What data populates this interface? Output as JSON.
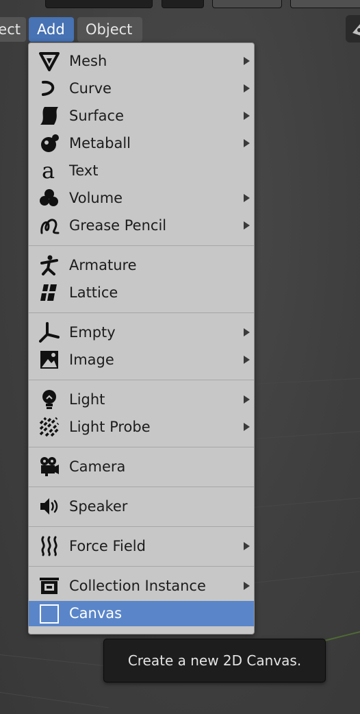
{
  "header": {
    "clipped_menu_label": "ect",
    "add_label": "Add",
    "object_label": "Object"
  },
  "menu": {
    "items": [
      {
        "label": "Mesh",
        "icon": "mesh-cone-icon",
        "submenu": true
      },
      {
        "label": "Curve",
        "icon": "curve-icon",
        "submenu": true
      },
      {
        "label": "Surface",
        "icon": "surface-icon",
        "submenu": true
      },
      {
        "label": "Metaball",
        "icon": "metaball-icon",
        "submenu": true
      },
      {
        "label": "Text",
        "icon": "text-icon",
        "submenu": false
      },
      {
        "label": "Volume",
        "icon": "volume-icon",
        "submenu": true
      },
      {
        "label": "Grease Pencil",
        "icon": "grease-pencil-icon",
        "submenu": true
      },
      {
        "label": "Armature",
        "icon": "armature-icon",
        "submenu": false
      },
      {
        "label": "Lattice",
        "icon": "lattice-icon",
        "submenu": false
      },
      {
        "label": "Empty",
        "icon": "empty-icon",
        "submenu": true
      },
      {
        "label": "Image",
        "icon": "image-icon",
        "submenu": true
      },
      {
        "label": "Light",
        "icon": "light-bulb-icon",
        "submenu": true
      },
      {
        "label": "Light Probe",
        "icon": "light-probe-icon",
        "submenu": true
      },
      {
        "label": "Camera",
        "icon": "camera-icon",
        "submenu": false
      },
      {
        "label": "Speaker",
        "icon": "speaker-icon",
        "submenu": false
      },
      {
        "label": "Force Field",
        "icon": "force-field-icon",
        "submenu": true
      },
      {
        "label": "Collection Instance",
        "icon": "collection-icon",
        "submenu": true
      },
      {
        "label": "Canvas",
        "icon": "canvas-icon",
        "submenu": false,
        "highlighted": true
      }
    ]
  },
  "tooltip": {
    "text": "Create a new 2D Canvas."
  },
  "colors": {
    "menu_bg": "#c7c7c7",
    "highlight": "#5a86c9",
    "active_header": "#4772b3",
    "tooltip_bg": "#1d1d1d"
  }
}
